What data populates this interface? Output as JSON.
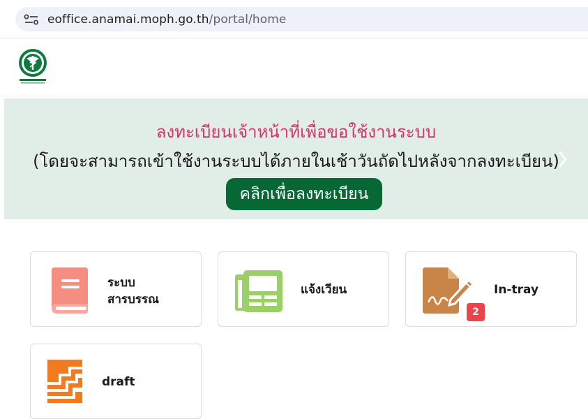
{
  "browser": {
    "url_host": "eoffice.anamai.moph.go.th",
    "url_path": "/portal/home"
  },
  "banner": {
    "title": "ลงทะเบียนเจ้าหน้าที่เพื่อขอใช้งานระบบ",
    "subtitle": "(โดยจะสามารถเข้าใช้งานระบบได้ภายในเช้าวันถัดไปหลังจากลงทะเบียน)",
    "button_label": "คลิกเพื่อลงทะเบียน",
    "background_color": "#e1ede7",
    "title_color": "#d6336c",
    "button_color": "#076735"
  },
  "apps": [
    {
      "label_line1": "ระบบ",
      "label_line2": "สารบรรณ",
      "icon": "book-icon",
      "color": "#f58d82"
    },
    {
      "label": "แจ้งเวียน",
      "icon": "newspaper-icon",
      "color": "#9ad067"
    },
    {
      "label": "In-tray",
      "icon": "signature-document-icon",
      "color": "#c98548",
      "badge": "2"
    },
    {
      "label": "draft",
      "icon": "stacked-documents-icon",
      "color": "#f27b20"
    }
  ]
}
